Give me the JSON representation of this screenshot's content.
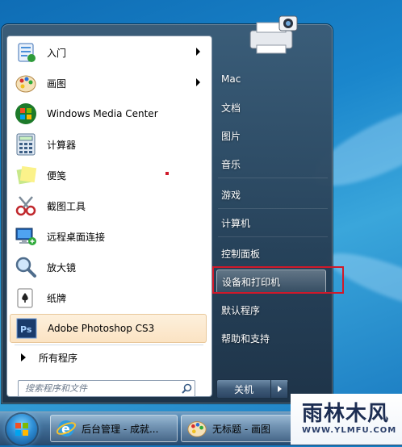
{
  "left_pane": {
    "programs": [
      {
        "label": "入门",
        "icon": "getting-started-icon",
        "has_submenu": true
      },
      {
        "label": "画图",
        "icon": "paint-icon",
        "has_submenu": true
      },
      {
        "label": "Windows Media Center",
        "icon": "media-center-icon",
        "has_submenu": false
      },
      {
        "label": "计算器",
        "icon": "calculator-icon",
        "has_submenu": false
      },
      {
        "label": "便笺",
        "icon": "sticky-notes-icon",
        "has_submenu": false
      },
      {
        "label": "截图工具",
        "icon": "snipping-tool-icon",
        "has_submenu": false
      },
      {
        "label": "远程桌面连接",
        "icon": "remote-desktop-icon",
        "has_submenu": false
      },
      {
        "label": "放大镜",
        "icon": "magnifier-icon",
        "has_submenu": false
      },
      {
        "label": "纸牌",
        "icon": "solitaire-icon",
        "has_submenu": false
      },
      {
        "label": "Adobe Photoshop CS3",
        "icon": "photoshop-icon",
        "has_submenu": false,
        "highlighted": true
      }
    ],
    "all_programs": "所有程序",
    "search_placeholder": "搜索程序和文件"
  },
  "right_pane": {
    "items": [
      {
        "label": "Mac"
      },
      {
        "label": "文档"
      },
      {
        "label": "图片"
      },
      {
        "label": "音乐"
      },
      {
        "label": "游戏"
      },
      {
        "label": "计算机"
      },
      {
        "label": "控制面板"
      },
      {
        "label": "设备和打印机",
        "hover": true
      },
      {
        "label": "默认程序"
      },
      {
        "label": "帮助和支持"
      }
    ],
    "shutdown_label": "关机"
  },
  "taskbar": {
    "buttons": [
      {
        "label": "后台管理 - 成就...",
        "icon": "ie-icon"
      },
      {
        "label": "无标题 - 画图",
        "icon": "paint-icon"
      }
    ]
  },
  "watermark": {
    "title": "雨林木风",
    "url": "WWW.YLMFU.COM"
  },
  "colors": {
    "highlight_box": "#d0192a",
    "menu_bg": "#2f4a66"
  }
}
